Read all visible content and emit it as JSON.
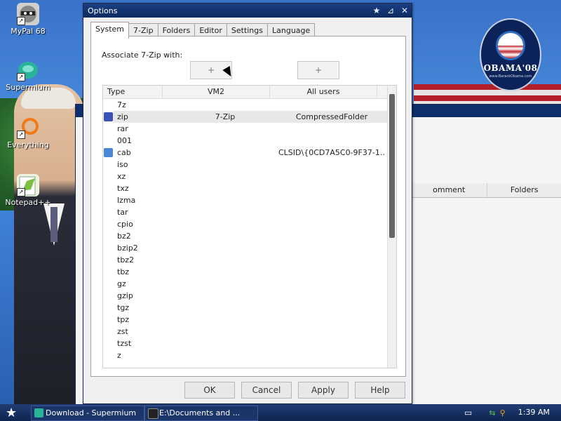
{
  "desktop": {
    "icons": [
      {
        "label": "MyPal 68",
        "icon": "raccoon-icon"
      },
      {
        "label": "Supermium",
        "icon": "supermium-icon"
      },
      {
        "label": "Everything",
        "icon": "everything-search-icon"
      },
      {
        "label": "Notepad++",
        "icon": "notepadpp-icon"
      }
    ],
    "logo": {
      "text": "OBAMA'08",
      "url": "www.BarackObama.com"
    }
  },
  "background_window": {
    "column_headers": [
      "omment",
      "Folders"
    ]
  },
  "dialog": {
    "title": "Options",
    "tabs": [
      {
        "label": "System",
        "active": true
      },
      {
        "label": "7-Zip",
        "active": false
      },
      {
        "label": "Folders",
        "active": false
      },
      {
        "label": "Editor",
        "active": false
      },
      {
        "label": "Settings",
        "active": false
      },
      {
        "label": "Language",
        "active": false
      }
    ],
    "associate_label": "Associate 7-Zip with:",
    "plus_button_label": "+",
    "columns": [
      "Type",
      "VM2",
      "All users"
    ],
    "rows": [
      {
        "type": "7z",
        "vm2": "",
        "all": ""
      },
      {
        "type": "zip",
        "vm2": "7-Zip",
        "all": "CompressedFolder",
        "selected": true,
        "icon": "zip-archive-icon"
      },
      {
        "type": "rar",
        "vm2": "",
        "all": ""
      },
      {
        "type": "001",
        "vm2": "",
        "all": ""
      },
      {
        "type": "cab",
        "vm2": "",
        "all": "CLSID\\{0CD7A5C0-9F37-1...",
        "icon": "cabinet-file-icon"
      },
      {
        "type": "iso",
        "vm2": "",
        "all": ""
      },
      {
        "type": "xz",
        "vm2": "",
        "all": ""
      },
      {
        "type": "txz",
        "vm2": "",
        "all": ""
      },
      {
        "type": "lzma",
        "vm2": "",
        "all": ""
      },
      {
        "type": "tar",
        "vm2": "",
        "all": ""
      },
      {
        "type": "cpio",
        "vm2": "",
        "all": ""
      },
      {
        "type": "bz2",
        "vm2": "",
        "all": ""
      },
      {
        "type": "bzip2",
        "vm2": "",
        "all": ""
      },
      {
        "type": "tbz2",
        "vm2": "",
        "all": ""
      },
      {
        "type": "tbz",
        "vm2": "",
        "all": ""
      },
      {
        "type": "gz",
        "vm2": "",
        "all": ""
      },
      {
        "type": "gzip",
        "vm2": "",
        "all": ""
      },
      {
        "type": "tgz",
        "vm2": "",
        "all": ""
      },
      {
        "type": "tpz",
        "vm2": "",
        "all": ""
      },
      {
        "type": "zst",
        "vm2": "",
        "all": ""
      },
      {
        "type": "tzst",
        "vm2": "",
        "all": ""
      },
      {
        "type": "z",
        "vm2": "",
        "all": ""
      }
    ],
    "buttons": {
      "ok": "OK",
      "cancel": "Cancel",
      "apply": "Apply",
      "help": "Help"
    }
  },
  "taskbar": {
    "items": [
      {
        "label": "Download - Supermium",
        "icon": "supermium-icon"
      },
      {
        "label": "E:\\Documents and ...",
        "icon": "7zip-icon"
      }
    ],
    "clock": "1:39 AM"
  }
}
